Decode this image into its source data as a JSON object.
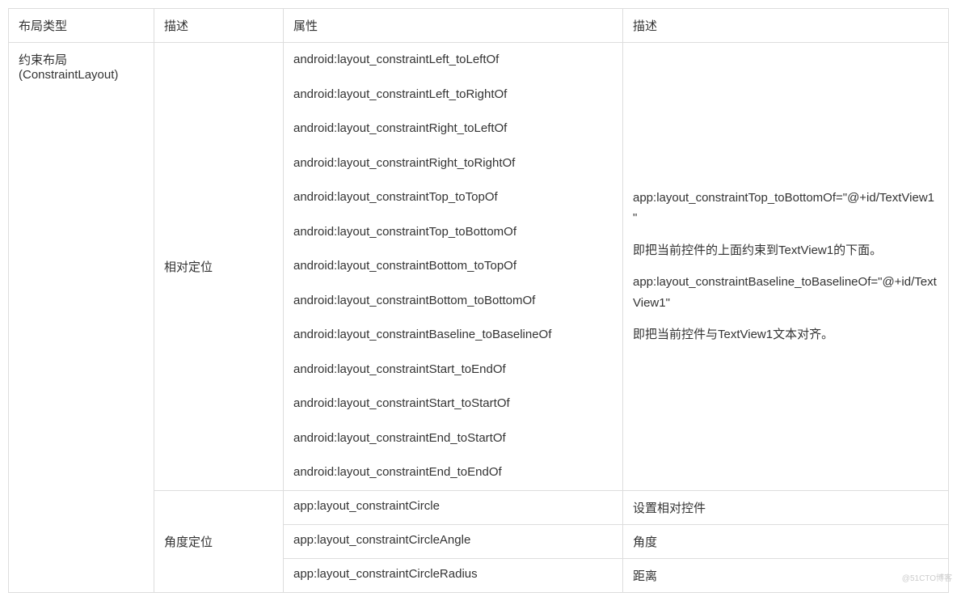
{
  "headers": {
    "c1": "布局类型",
    "c2": "描述",
    "c3": "属性",
    "c4": "描述"
  },
  "layout_type": "约束布局(ConstraintLayout)",
  "rows": {
    "relative": {
      "desc": "相对定位",
      "attrs": [
        "android:layout_constraintLeft_toLeftOf",
        "android:layout_constraintLeft_toRightOf",
        "android:layout_constraintRight_toLeftOf",
        "android:layout_constraintRight_toRightOf",
        "android:layout_constraintTop_toTopOf",
        "android:layout_constraintTop_toBottomOf",
        "android:layout_constraintBottom_toTopOf",
        "android:layout_constraintBottom_toBottomOf",
        "android:layout_constraintBaseline_toBaselineOf",
        "android:layout_constraintStart_toEndOf",
        "android:layout_constraintStart_toStartOf",
        "android:layout_constraintEnd_toStartOf",
        "android:layout_constraintEnd_toEndOf"
      ],
      "detail": {
        "p1": "app:layout_constraintTop_toBottomOf=\"@+id/TextView1\"",
        "p2": "即把当前控件的上面约束到TextView1的下面。",
        "p3": "app:layout_constraintBaseline_toBaselineOf=\"@+id/TextView1\"",
        "p4": "即把当前控件与TextView1文本对齐。"
      }
    },
    "angle": {
      "desc": "角度定位",
      "items": [
        {
          "attr": "app:layout_constraintCircle",
          "detail": "设置相对控件"
        },
        {
          "attr": "app:layout_constraintCircleAngle",
          "detail": "角度"
        },
        {
          "attr": "app:layout_constraintCircleRadius",
          "detail": "距离"
        }
      ]
    }
  },
  "watermark": "@51CTO博客"
}
